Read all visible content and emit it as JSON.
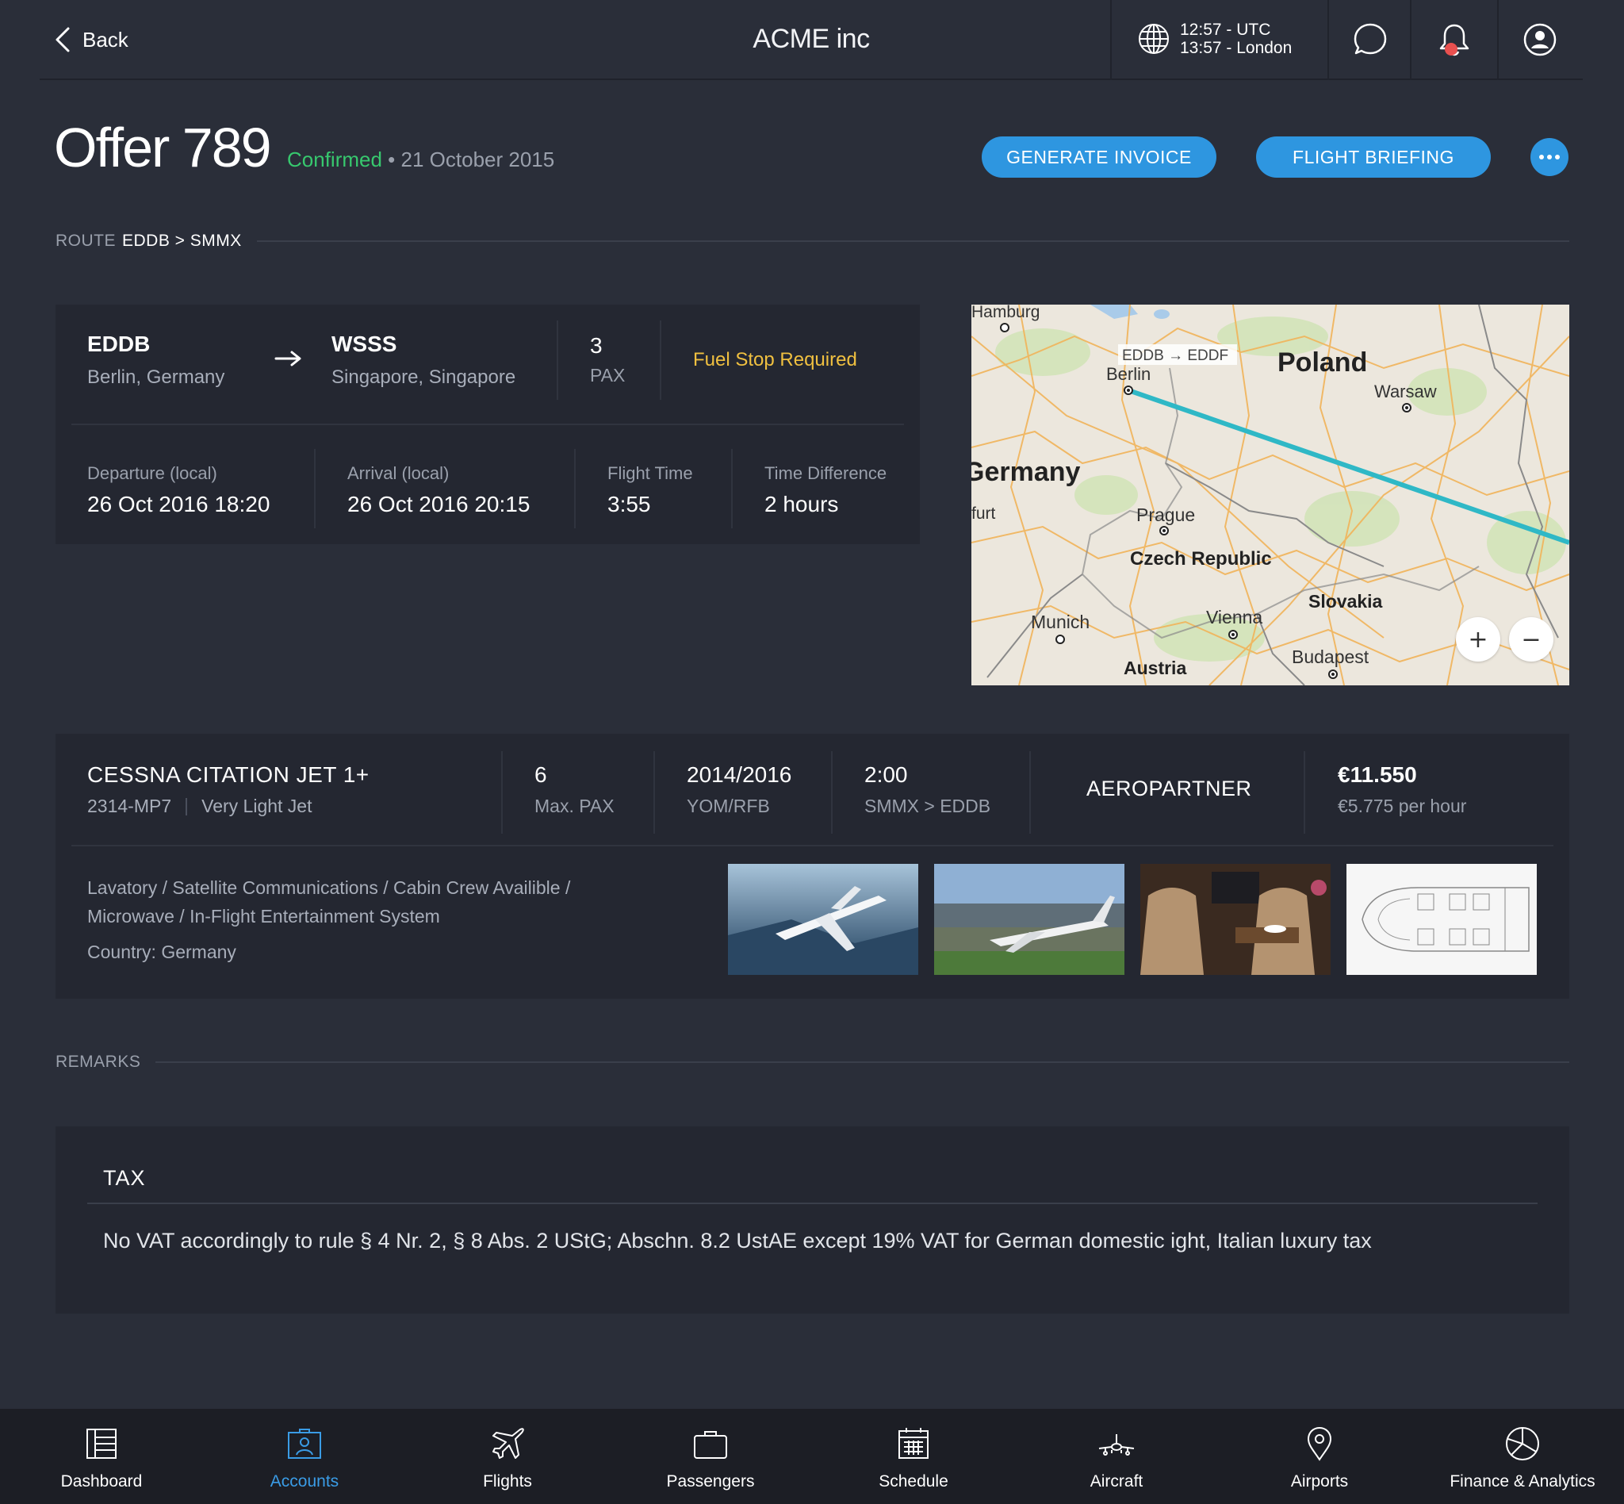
{
  "topbar": {
    "back_label": "Back",
    "app_title": "ACME inc",
    "time_utc": "12:57 - UTC",
    "time_local": "13:57 - London"
  },
  "header": {
    "title": "Offer 789",
    "status": "Confirmed",
    "separator": "•",
    "date": "21 October 2015",
    "generate_invoice": "GENERATE INVOICE",
    "flight_briefing": "FLIGHT BRIEFING"
  },
  "route_section": {
    "label": "ROUTE",
    "value": "EDDB > SMMX"
  },
  "route": {
    "from_code": "EDDB",
    "from_city": "Berlin, Germany",
    "to_code": "WSSS",
    "to_city": "Singapore, Singapore",
    "pax_count": "3",
    "pax_label": "PAX",
    "notice": "Fuel Stop Required",
    "departure_label": "Departure (local)",
    "departure_value": "26 Oct 2016 18:20",
    "arrival_label": "Arrival (local)",
    "arrival_value": "26 Oct 2016 20:15",
    "flight_time_label": "Flight Time",
    "flight_time_value": "3:55",
    "time_diff_label": "Time Difference",
    "time_diff_value": "2 hours"
  },
  "map": {
    "leg_label": "EDDB → EDDF",
    "places": {
      "hamburg": "Hamburg",
      "berlin": "Berlin",
      "poland": "Poland",
      "warsaw": "Warsaw",
      "germany": "Germany",
      "furt": "furt",
      "prague": "Prague",
      "czech": "Czech Republic",
      "slovakia": "Slovakia",
      "munich": "Munich",
      "vienna": "Vienna",
      "budapest": "Budapest",
      "austria": "Austria"
    },
    "zoom_in": "+",
    "zoom_out": "−",
    "route_color": "#2fb8c6"
  },
  "aircraft": {
    "model": "CESSNA CITATION JET 1+",
    "registration": "2314-MP7",
    "category": "Very Light Jet",
    "max_pax_value": "6",
    "max_pax_label": "Max. PAX",
    "yom_value": "2014/2016",
    "yom_label": "YOM/RFB",
    "duration_value": "2:00",
    "duration_route": "SMMX > EDDB",
    "operator": "AEROPARTNER",
    "price": "€11.550",
    "rate": "€5.775 per hour",
    "features_line1": "Lavatory / Satellite Communications / Cabin Crew Availible /",
    "features_line2": "Microwave / In-Flight Entertainment System",
    "country": "Country: Germany"
  },
  "remarks_section": {
    "label": "REMARKS"
  },
  "remarks": {
    "title": "TAX",
    "text": "No VAT accordingly to rule § 4 Nr. 2, § 8 Abs. 2 UStG; Abschn. 8.2 UstAE except 19% VAT for German domestic ight, Italian luxury tax"
  },
  "nav": [
    {
      "label": "Dashboard",
      "icon": "dashboard-icon"
    },
    {
      "label": "Accounts",
      "icon": "accounts-icon",
      "active": true
    },
    {
      "label": "Flights",
      "icon": "plane-icon"
    },
    {
      "label": "Passengers",
      "icon": "briefcase-icon"
    },
    {
      "label": "Schedule",
      "icon": "calendar-icon"
    },
    {
      "label": "Aircraft",
      "icon": "aircraft-icon"
    },
    {
      "label": "Airports",
      "icon": "pin-icon"
    },
    {
      "label": "Finance & Analytics",
      "icon": "pie-chart-icon"
    }
  ],
  "colors": {
    "background": "#2a2e39",
    "card": "#242731",
    "accent": "#2e96e0",
    "success": "#37c86e",
    "warning": "#f0c040",
    "alert": "#e9504f"
  }
}
